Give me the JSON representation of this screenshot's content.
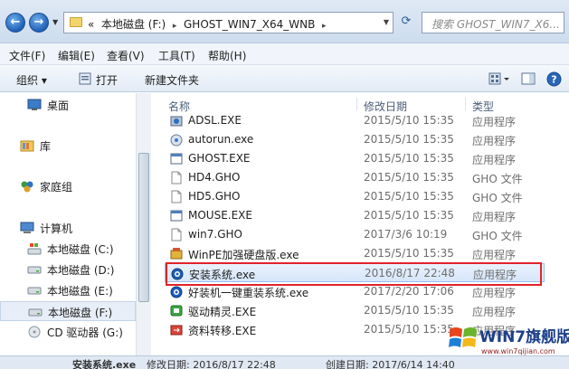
{
  "address_bar": {
    "prefix": "«",
    "segment1": "本地磁盘 (F:)",
    "separator": "▸",
    "segment2": "GHOST_WIN7_X64_WNB",
    "search_placeholder": "搜索 GHOST_WIN7_X6..."
  },
  "menu": [
    "文件(F)",
    "编辑(E)",
    "查看(V)",
    "工具(T)",
    "帮助(H)"
  ],
  "toolbar": {
    "organize": "组织 ▾",
    "open": "打开",
    "new_folder": "新建文件夹"
  },
  "sidebar": {
    "desktop": "桌面",
    "library": "库",
    "homegroup": "家庭组",
    "computer": "计算机",
    "drives": [
      "本地磁盘 (C:)",
      "本地磁盘 (D:)",
      "本地磁盘 (E:)",
      "本地磁盘 (F:)",
      "CD 驱动器 (G:)"
    ]
  },
  "columns": {
    "name": "名称",
    "date": "修改日期",
    "type": "类型"
  },
  "files": [
    {
      "name": "ADSL.EXE",
      "date": "2015/5/10 15:35",
      "type": "应用程序",
      "icon": "network-exe-icon"
    },
    {
      "name": "autorun.exe",
      "date": "2015/5/10 15:35",
      "type": "应用程序",
      "icon": "cd-exe-icon"
    },
    {
      "name": "GHOST.EXE",
      "date": "2015/5/10 15:35",
      "type": "应用程序",
      "icon": "window-exe-icon"
    },
    {
      "name": "HD4.GHO",
      "date": "2015/5/10 15:35",
      "type": "GHO 文件",
      "icon": "blank-file-icon"
    },
    {
      "name": "HD5.GHO",
      "date": "2015/5/10 15:35",
      "type": "GHO 文件",
      "icon": "blank-file-icon"
    },
    {
      "name": "MOUSE.EXE",
      "date": "2015/5/10 15:35",
      "type": "应用程序",
      "icon": "window-exe-icon"
    },
    {
      "name": "win7.GHO",
      "date": "2017/3/6 10:19",
      "type": "GHO 文件",
      "icon": "blank-file-icon"
    },
    {
      "name": "WinPE加强硬盘版.exe",
      "date": "2015/5/10 15:35",
      "type": "应用程序",
      "icon": "tools-exe-icon"
    },
    {
      "name": "安装系统.exe",
      "date": "2016/8/17 22:48",
      "type": "应用程序",
      "icon": "install-exe-icon"
    },
    {
      "name": "好装机一键重装系统.exe",
      "date": "2017/2/20 17:06",
      "type": "应用程序",
      "icon": "install-exe-icon"
    },
    {
      "name": "驱动精灵.EXE",
      "date": "2015/5/10 15:35",
      "type": "应用程序",
      "icon": "driver-exe-icon"
    },
    {
      "name": "资料转移.EXE",
      "date": "2015/5/10 15:35",
      "type": "应用程序",
      "icon": "transfer-exe-icon"
    }
  ],
  "status": {
    "name": "安装系统.exe",
    "modified": "修改日期: 2016/8/17 22:48",
    "created": "创建日期: 2017/6/14 14:40"
  },
  "watermark": {
    "title": "WIN7旗舰版",
    "url": "www.win7qijian.com"
  }
}
